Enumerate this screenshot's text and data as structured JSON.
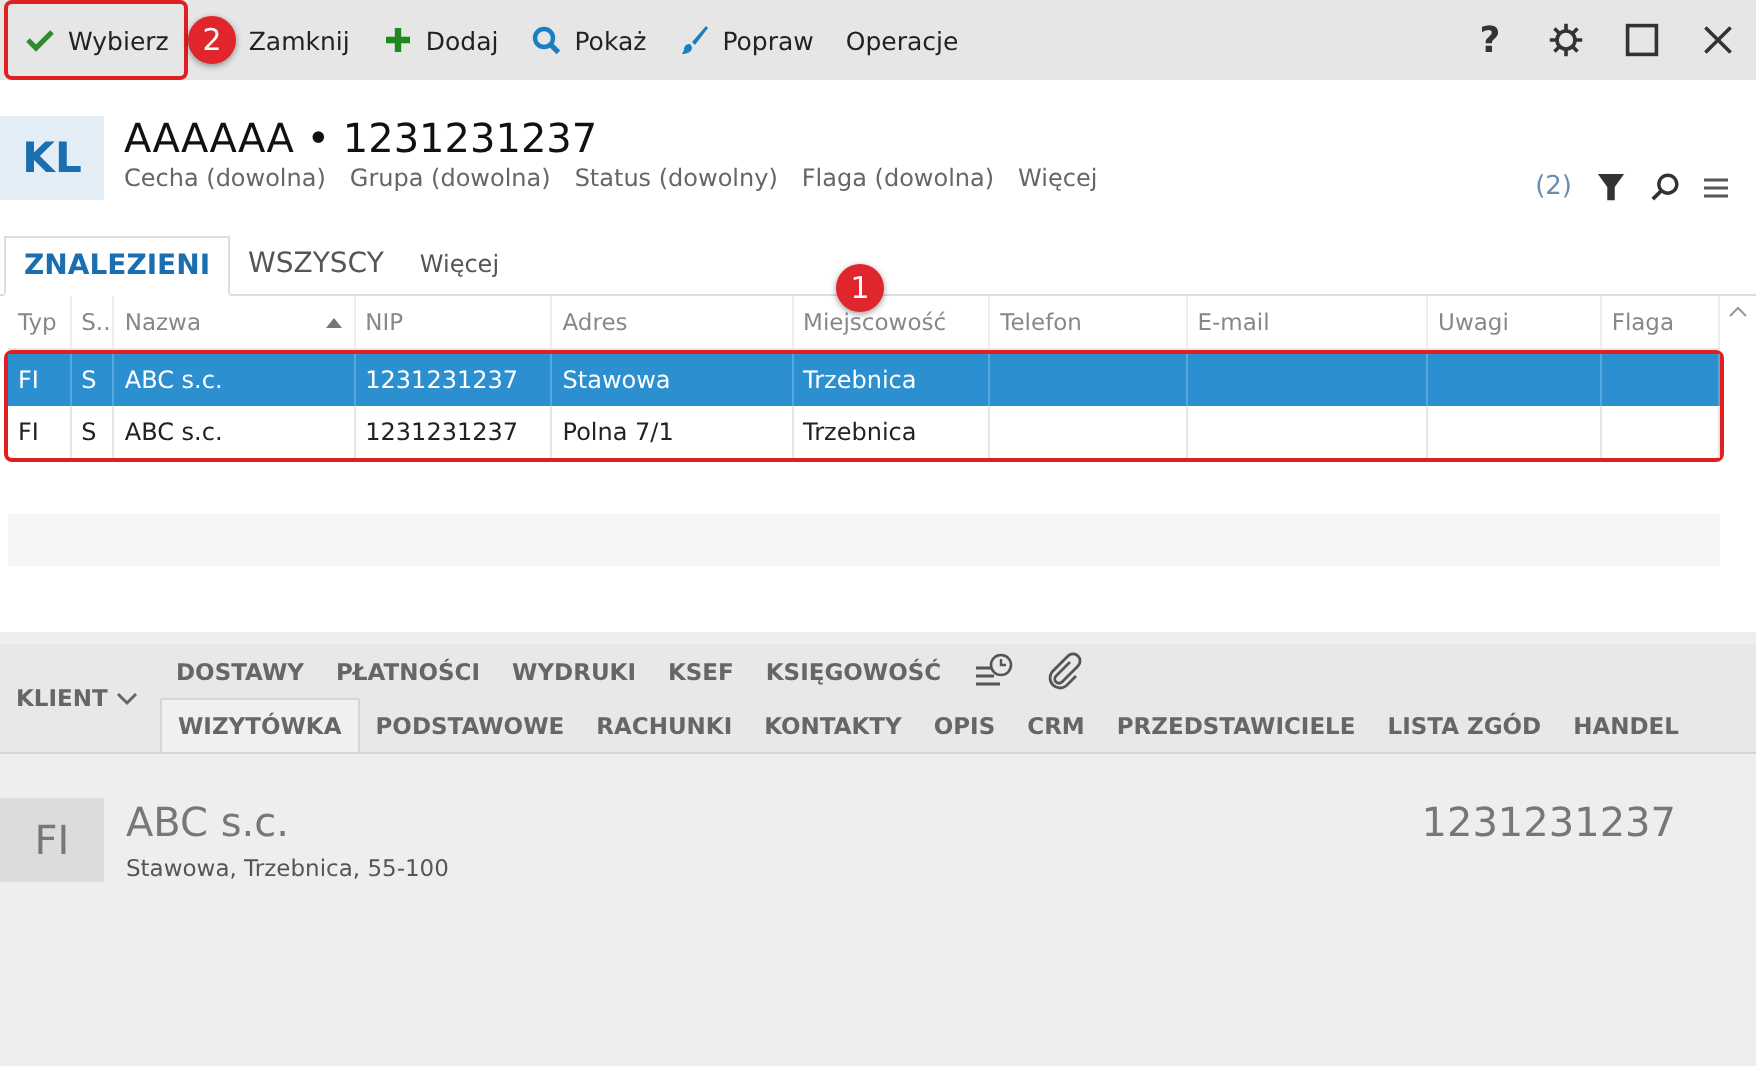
{
  "toolbar": {
    "buttons": [
      {
        "kind": "check",
        "label": "Wybierz",
        "highlighted": true
      },
      {
        "kind": "none",
        "label": "Zamknij",
        "highlighted": false
      },
      {
        "kind": "plus",
        "label": "Dodaj",
        "highlighted": false
      },
      {
        "kind": "search",
        "label": "Pokaż",
        "highlighted": false
      },
      {
        "kind": "brush",
        "label": "Popraw",
        "highlighted": false
      },
      {
        "kind": "none",
        "label": "Operacje",
        "highlighted": false
      }
    ],
    "window_controls": [
      {
        "kind": "help",
        "label": "?"
      },
      {
        "kind": "settings"
      },
      {
        "kind": "maximize"
      },
      {
        "kind": "close"
      }
    ]
  },
  "header": {
    "badge": "KL",
    "title": "AAAAAA • 1231231237",
    "filters": [
      "Cecha (dowolna)",
      "Grupa (dowolna)",
      "Status (dowolny)",
      "Flaga (dowolna)",
      "Więcej"
    ],
    "count": "(2)"
  },
  "tabs": [
    {
      "label": "ZNALEZIENI",
      "selected": true
    },
    {
      "label": "WSZYSCY",
      "selected": false
    },
    {
      "label": "Więcej",
      "selected": false
    }
  ],
  "table": {
    "columns": [
      "Typ",
      "S..",
      "Nazwa",
      "NIP",
      "Adres",
      "Miejscowość",
      "Telefon",
      "E-mail",
      "Uwagi",
      "Flaga"
    ],
    "rows": [
      {
        "cells": [
          "FI",
          "S",
          "ABC s.c.",
          "1231231237",
          "Stawowa",
          "Trzebnica",
          "",
          "",
          "",
          ""
        ],
        "selected": true
      },
      {
        "cells": [
          "FI",
          "S",
          "ABC s.c.",
          "1231231237",
          "Polna 7/1",
          "Trzebnica",
          "",
          "",
          "",
          ""
        ],
        "selected": false
      }
    ]
  },
  "annotations": [
    {
      "label": "1"
    },
    {
      "label": "2"
    }
  ],
  "detail": {
    "menu": "KLIENT",
    "tabs_top": [
      {
        "label": "DOSTAWY",
        "kind": "text"
      },
      {
        "label": "PŁATNOŚCI",
        "kind": "text"
      },
      {
        "label": "WYDRUKI",
        "kind": "text"
      },
      {
        "label": "KSEF",
        "kind": "text"
      },
      {
        "label": "KSIĘGOWOŚĆ",
        "kind": "text"
      },
      {
        "kind": "history"
      },
      {
        "kind": "attachment"
      }
    ],
    "tabs_bottom": [
      {
        "label": "WIZYTÓWKA",
        "selected": true
      },
      {
        "label": "PODSTAWOWE",
        "selected": false
      },
      {
        "label": "RACHUNKI",
        "selected": false
      },
      {
        "label": "KONTAKTY",
        "selected": false
      },
      {
        "label": "OPIS",
        "selected": false
      },
      {
        "label": "CRM",
        "selected": false
      },
      {
        "label": "PRZEDSTAWICIELE",
        "selected": false
      },
      {
        "label": "LISTA ZGÓD",
        "selected": false
      },
      {
        "label": "HANDEL",
        "selected": false
      }
    ],
    "card": {
      "badge": "FI",
      "name": "ABC s.c.",
      "address": "Stawowa, Trzebnica, 55-100",
      "nip": "1231231237"
    }
  }
}
